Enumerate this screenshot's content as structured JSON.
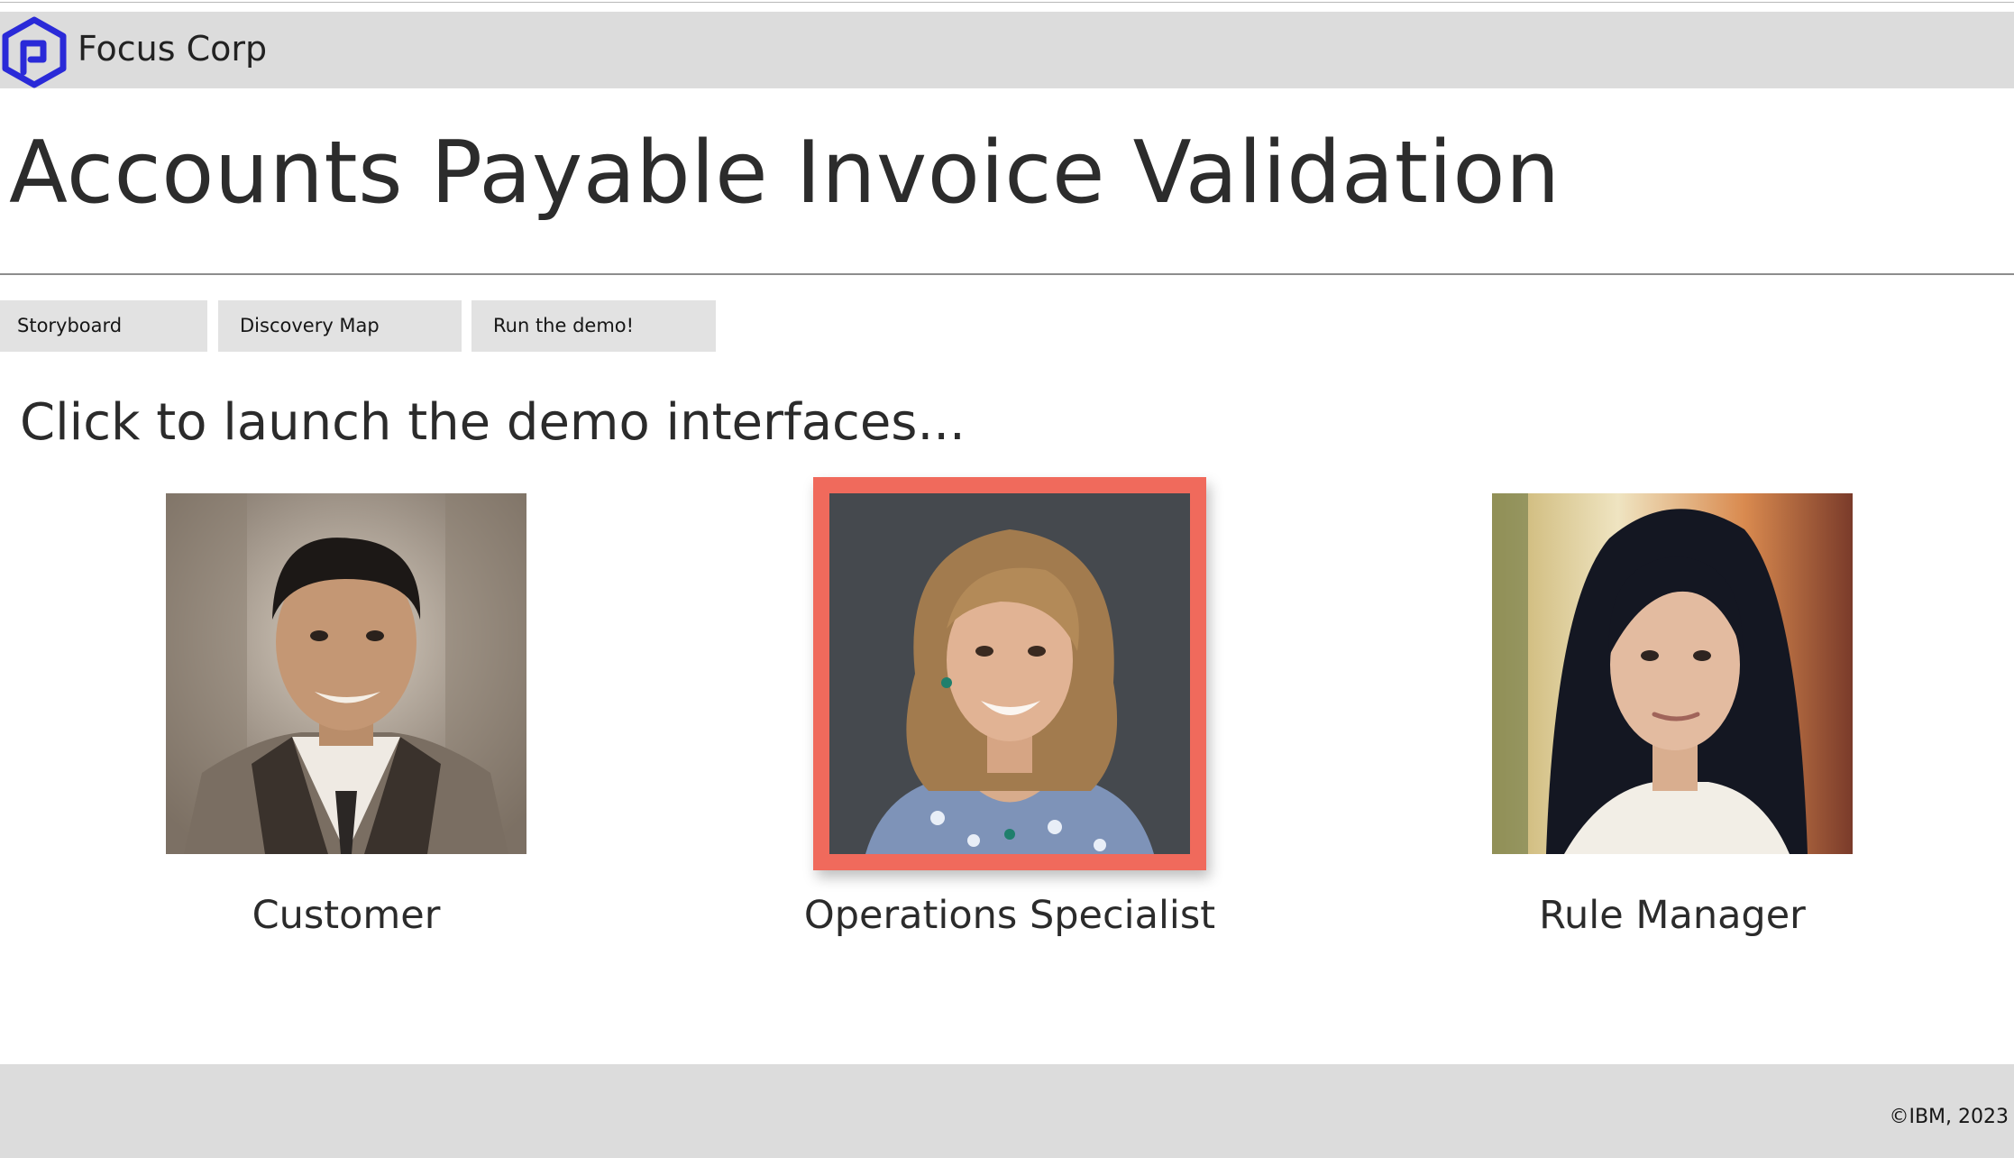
{
  "header": {
    "brand": "Focus Corp",
    "logo_icon": "hexagon-logo-icon",
    "brand_color": "#2a2ad8"
  },
  "page_title": "Accounts Payable Invoice Validation",
  "tabs": [
    {
      "label": "Storyboard"
    },
    {
      "label": "Discovery Map"
    },
    {
      "label": "Run the demo!"
    }
  ],
  "subhead": "Click to launch the demo interfaces...",
  "personas": [
    {
      "name": "Customer",
      "selected": false
    },
    {
      "name": "Operations Specialist",
      "selected": true
    },
    {
      "name": "Rule Manager",
      "selected": false
    }
  ],
  "selection_color": "#f06a5c",
  "footer": {
    "copyright": "©IBM, 2023"
  }
}
